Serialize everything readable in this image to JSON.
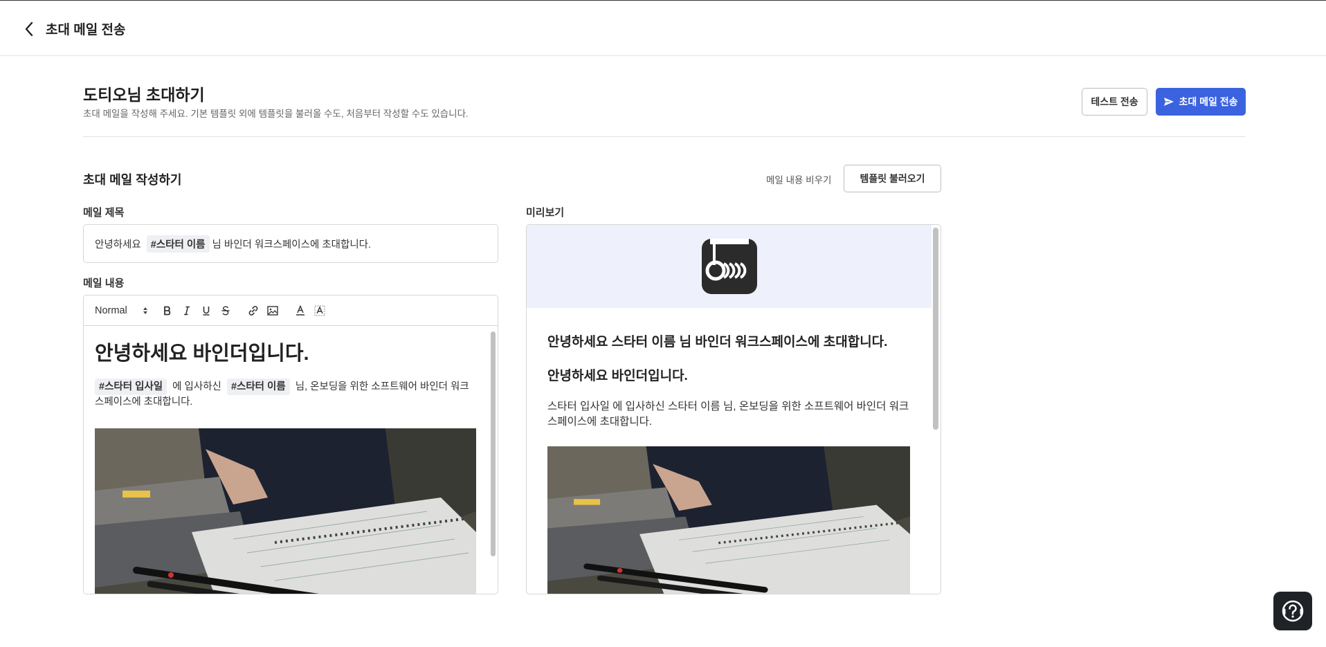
{
  "header": {
    "title": "초대 메일 전송"
  },
  "page": {
    "title": "도티오님 초대하기",
    "subtitle": "초대 메일을 작성해 주세요. 기본 템플릿 외에 템플릿을 불러올 수도, 처음부터 작성할 수도 있습니다.",
    "test_send_label": "테스트 전송",
    "send_label": "초대 메일 전송"
  },
  "compose": {
    "title": "초대 메일 작성하기",
    "clear_label": "메일 내용 비우기",
    "load_template_label": "템플릿 불러오기",
    "subject_label": "메일 제목",
    "subject": {
      "before": "안녕하세요",
      "tag": "#스타터 이름",
      "after": "님 바인더 워크스페이스에 초대합니다."
    },
    "content_label": "메일 내용",
    "toolbar": {
      "format_value": "Normal"
    },
    "body": {
      "heading": "안녕하세요 바인더입니다.",
      "tag1": "#스타터 입사일",
      "text1": "에 입사하신",
      "tag2": "#스타터 이름",
      "text2": "님, 온보딩을 위한 소프트웨어 바인더 워크스페이스에 초대합니다."
    }
  },
  "preview": {
    "label": "미리보기",
    "subject": "안녕하세요 스타터 이름 님 바인더 워크스페이스에 초대합니다.",
    "heading": "안녕하세요 바인더입니다.",
    "paragraph": "스타터 입사일 에 입사하신 스타터 이름 님, 온보딩을 위한 소프트웨어 바인더 워크스페이스에 초대합니다."
  },
  "icons": {
    "back": "chevron-left-icon",
    "send": "paper-plane-icon",
    "help": "question-icon",
    "logo": "binder-logo-icon"
  },
  "colors": {
    "accent": "#3b63e0",
    "preview_header_bg": "#eef1fb",
    "help_bg": "#1f2328"
  }
}
